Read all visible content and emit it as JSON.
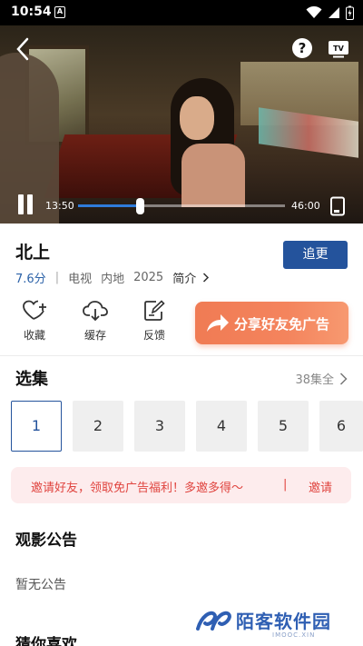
{
  "status_bar": {
    "time": "10:54",
    "notification_icon": "A"
  },
  "player": {
    "current_time": "13:50",
    "total_time": "46:00",
    "progress": 0.3,
    "help_label": "?",
    "accent": "#2f7bd9"
  },
  "show": {
    "title": "北上",
    "rating": "7.6分",
    "separator": "|",
    "category": "电视",
    "region": "内地",
    "year": "2025",
    "intro_label": "简介",
    "follow_label": "追更"
  },
  "actions": {
    "favorite": "收藏",
    "cache": "缓存",
    "feedback": "反馈",
    "share_banner": "分享好友免广告"
  },
  "episodes": {
    "title": "选集",
    "all_label": "38集全",
    "items": [
      "1",
      "2",
      "3",
      "4",
      "5",
      "6"
    ],
    "selected": "1"
  },
  "invite": {
    "text": "邀请好友，领取免广告福利！多邀多得～",
    "separator": "|",
    "link": "邀请"
  },
  "notice": {
    "title": "观影公告",
    "body": "暂无公告"
  },
  "guess": {
    "title": "猜你喜欢"
  },
  "watermark": {
    "name": "陌客软件园",
    "sub": "IMOOC.XIN"
  },
  "colors": {
    "brand": "#24539c",
    "share": "#f4845d",
    "invite_text": "#e0443f"
  }
}
